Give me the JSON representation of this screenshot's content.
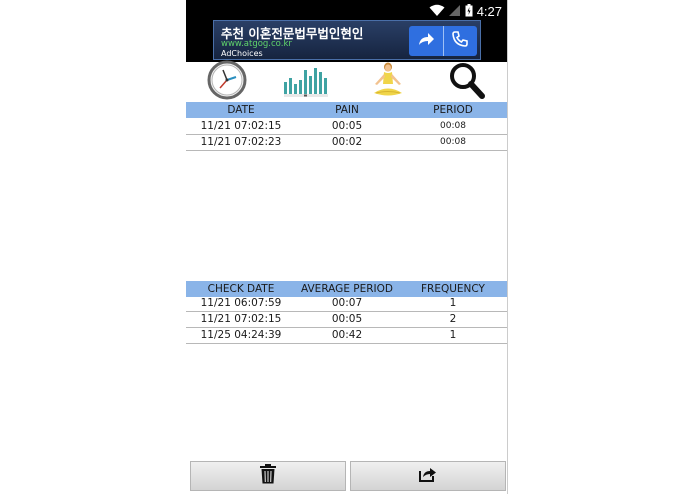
{
  "status_bar": {
    "time": "4:27"
  },
  "ad": {
    "title": "추천 이혼전문법무법인현인",
    "url": "www.atgog.co.kr",
    "choices": "AdChoices"
  },
  "toolbar": {
    "icons": [
      "clock-icon",
      "bar-chart-icon",
      "yoga-icon",
      "search-icon"
    ]
  },
  "pain_table": {
    "headers": [
      "DATE",
      "PAIN",
      "PERIOD"
    ],
    "rows": [
      {
        "date": "11/21 07:02:15",
        "pain": "00:05",
        "period": "00:08"
      },
      {
        "date": "11/21 07:02:23",
        "pain": "00:02",
        "period": "00:08"
      }
    ]
  },
  "summary_table": {
    "headers": [
      "CHECK DATE",
      "AVERAGE PERIOD",
      "FREQUENCY"
    ],
    "rows": [
      {
        "check_date": "11/21 06:07:59",
        "average_period": "00:07",
        "frequency": "1"
      },
      {
        "check_date": "11/21 07:02:15",
        "average_period": "00:05",
        "frequency": "2"
      },
      {
        "check_date": "11/25 04:24:39",
        "average_period": "00:42",
        "frequency": "1"
      }
    ]
  },
  "bottom": {
    "icons": [
      "trash-icon",
      "share-icon"
    ]
  },
  "colors": {
    "header_bg": "#8ab4e8",
    "ad_button": "#2f6fe0"
  }
}
